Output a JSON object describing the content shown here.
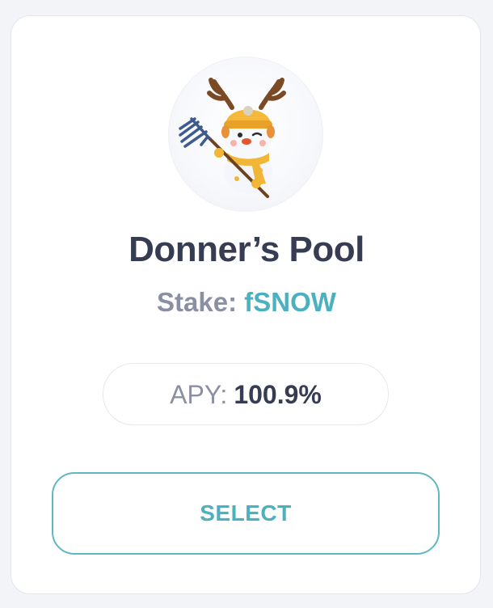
{
  "pool": {
    "title": "Donner’s Pool",
    "avatar_icon": "reindeer-snowman-with-pitchfork-icon",
    "stake_label": "Stake:",
    "stake_token": "fSNOW",
    "apy_label": "APY:",
    "apy_value": "100.9%",
    "select_label": "SELECT"
  },
  "colors": {
    "title": "#363c52",
    "muted": "#8b8fa2",
    "accent": "#4bb0bf",
    "button_border": "#5fb7c1",
    "background": "#f3f4f7"
  }
}
